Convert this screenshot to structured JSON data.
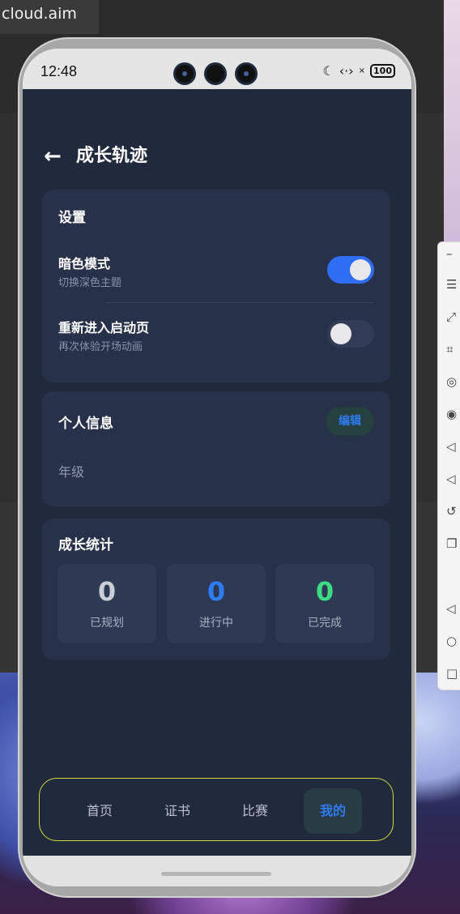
{
  "desktop": {
    "window_title": "cloud.aim"
  },
  "status_bar": {
    "time": "12:48",
    "battery": "100"
  },
  "header": {
    "back_icon": "arrow-left-icon",
    "title": "成长轨迹"
  },
  "settings": {
    "title": "设置",
    "items": [
      {
        "label": "暗色模式",
        "sub": "切换深色主题",
        "enabled": true
      },
      {
        "label": "重新进入启动页",
        "sub": "再次体验开场动画",
        "enabled": false
      }
    ]
  },
  "profile": {
    "title": "个人信息",
    "edit_label": "编辑",
    "field_label": "年级"
  },
  "stats": {
    "title": "成长统计",
    "items": [
      {
        "value": "0",
        "label": "已规划",
        "color": "#c9cdd6"
      },
      {
        "value": "0",
        "label": "进行中",
        "color": "#2f7bf4"
      },
      {
        "value": "0",
        "label": "已完成",
        "color": "#3ddc84"
      }
    ]
  },
  "nav": {
    "items": [
      {
        "label": "首页",
        "active": false
      },
      {
        "label": "证书",
        "active": false
      },
      {
        "label": "比赛",
        "active": false
      },
      {
        "label": "我的",
        "active": true
      }
    ]
  },
  "colors": {
    "screen_bg": "#212a3c",
    "card_bg": "#28314a",
    "accent": "#2f7bf4",
    "nav_border": "#d6d63a"
  }
}
